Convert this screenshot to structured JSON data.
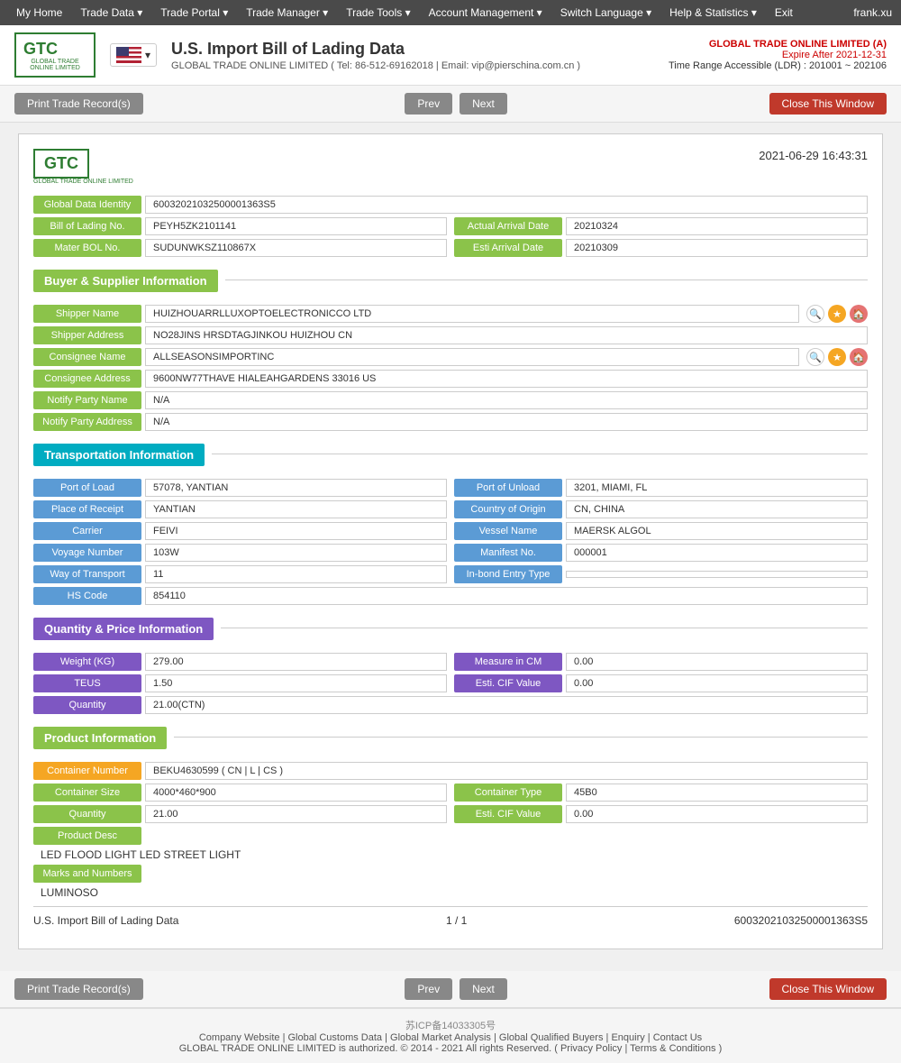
{
  "topNav": {
    "items": [
      "My Home",
      "Trade Data",
      "Trade Portal",
      "Trade Manager",
      "Trade Tools",
      "Account Management",
      "Switch Language",
      "Help & Statistics",
      "Exit"
    ],
    "user": "frank.xu"
  },
  "header": {
    "logo": "GTC",
    "logoSub": "GLOBAL TRADE ONLINE LIMITED",
    "title": "U.S. Import Bill of Lading Data",
    "subtitle": "GLOBAL TRADE ONLINE LIMITED ( Tel: 86-512-69162018 | Email: vip@pierschina.com.cn )",
    "company": "GLOBAL TRADE ONLINE LIMITED (A)",
    "expire": "Expire After 2021-12-31",
    "timeRange": "Time Range Accessible (LDR) : 201001 ~ 202106"
  },
  "toolbar": {
    "printBtn": "Print Trade Record(s)",
    "prevBtn": "Prev",
    "nextBtn": "Next",
    "closeBtn": "Close This Window"
  },
  "document": {
    "logo": "GTC",
    "logoSub": "GLOBAL TRADE ONLINE LIMITED",
    "timestamp": "2021-06-29 16:43:31",
    "globalDataIdentity": "60032021032500001363S5",
    "billOfLadingNo": "PEYH5ZK2101141",
    "actualArrivalDate": "20210324",
    "masterBOLNo": "SUDUNWKSZ110867X",
    "estiArrivalDate": "20210309",
    "sections": {
      "buyerSupplier": {
        "title": "Buyer & Supplier Information",
        "shipperName": "HUIZHOUARRLLUXOPTOELECTRONICCO LTD",
        "shipperAddress": "NO28JINS HRSDTAGJINKOU HUIZHOU CN",
        "consigneeName": "ALLSEASONSIMPORTINC",
        "consigneeAddress": "9600NW77THAVE HIALEAHGARDENS 33016 US",
        "notifyPartyName": "N/A",
        "notifyPartyAddress": "N/A"
      },
      "transportation": {
        "title": "Transportation Information",
        "portOfLoad": "57078, YANTIAN",
        "portOfUnload": "3201, MIAMI, FL",
        "placeOfReceipt": "YANTIAN",
        "countryOfOrigin": "CN, CHINA",
        "carrier": "FEIVI",
        "vesselName": "MAERSK ALGOL",
        "voyageNumber": "103W",
        "manifestNo": "000001",
        "wayOfTransport": "11",
        "inBondEntryType": "",
        "hsCode": "854110"
      },
      "quantityPrice": {
        "title": "Quantity & Price Information",
        "weightKG": "279.00",
        "measureInCM": "0.00",
        "teus": "1.50",
        "estiCIFValue": "0.00",
        "quantity": "21.00(CTN)"
      },
      "product": {
        "title": "Product Information",
        "containerNumber": "BEKU4630599 ( CN | L | CS )",
        "containerSize": "4000*460*900",
        "containerType": "45B0",
        "quantity": "21.00",
        "estiCIFValue": "0.00",
        "productDesc": "LED FLOOD LIGHT LED STREET LIGHT",
        "marksAndNumbers": "LUMINOSO"
      }
    },
    "footer": {
      "docTitle": "U.S. Import Bill of Lading Data",
      "pageInfo": "1 / 1",
      "recordId": "60032021032500001363S5"
    }
  },
  "bottomToolbar": {
    "printBtn": "Print Trade Record(s)",
    "prevBtn": "Prev",
    "nextBtn": "Next",
    "closeBtn": "Close This Window"
  },
  "pageFooter": {
    "icp": "苏ICP备14033305号",
    "links": [
      "Company Website",
      "Global Customs Data",
      "Global Market Analysis",
      "Global Qualified Buyers",
      "Enquiry",
      "Contact Us"
    ],
    "copyright": "GLOBAL TRADE ONLINE LIMITED is authorized. © 2014 - 2021 All rights Reserved. (  Privacy Policy  |  Terms & Conditions  )"
  }
}
